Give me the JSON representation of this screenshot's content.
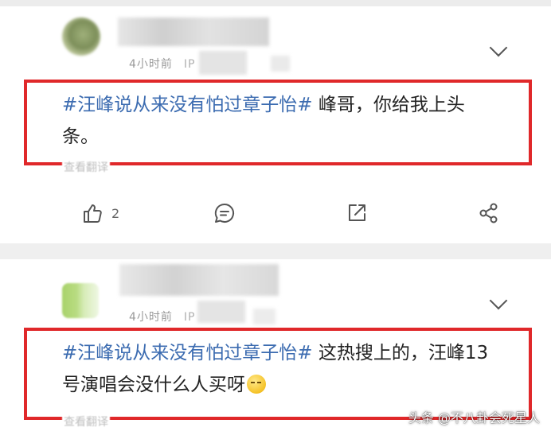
{
  "posts": [
    {
      "time": "4小时前",
      "ip_label": "IP",
      "hashtag": "#汪峰说从来没有怕过章子怡#",
      "text": " 峰哥，你给我上头条。",
      "translate": "查看翻译",
      "like_count": "2"
    },
    {
      "time": "4小时前",
      "ip_label": "IP",
      "hashtag": "#汪峰说从来没有怕过章子怡#",
      "text": " 这热搜上的，汪峰13号演唱会没什么人买呀",
      "emoji": "grimace-emoji",
      "translate": "查看翻译"
    }
  ],
  "watermark": "头条 @不八卦会死星人",
  "colors": {
    "highlight_box": "#e0282a",
    "hashtag": "#3b6bb0"
  }
}
